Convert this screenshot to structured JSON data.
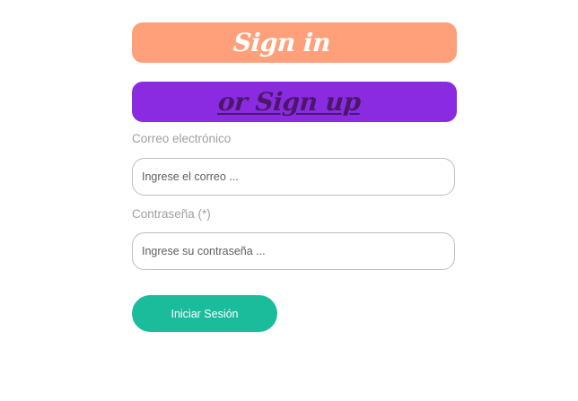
{
  "header": {
    "signin_label": "Sign in",
    "signup_label": "or Sign up"
  },
  "form": {
    "email": {
      "label": "Correo electrónico",
      "placeholder": "Ingrese el correo ..."
    },
    "password": {
      "label": "Contraseña (*)",
      "placeholder": "Ingrese su contraseña ..."
    },
    "submit_label": "Iniciar Sesión"
  },
  "colors": {
    "signin_banner": "#ffa07a",
    "signup_banner": "#8a2be2",
    "signup_text": "#4b1769",
    "submit_button": "#1abc9c",
    "label_text": "#a0a0a0",
    "field_border": "#bdbdbd"
  }
}
